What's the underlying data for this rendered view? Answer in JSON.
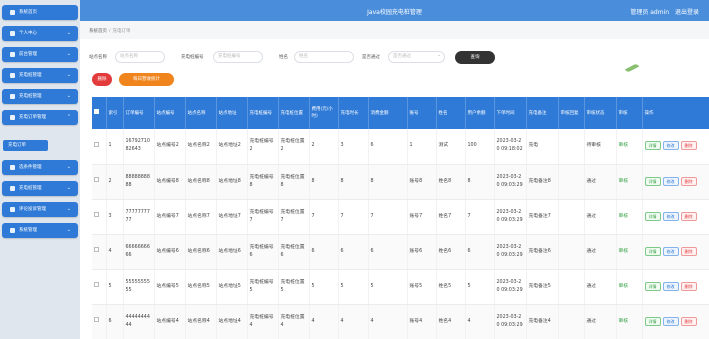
{
  "header": {
    "title": "Java校园充电桩管理",
    "user_label": "管理员 admin",
    "logout": "退出登录"
  },
  "sidebar": {
    "items": [
      {
        "label": "系统首页",
        "icon": "home-icon",
        "chevron": ""
      },
      {
        "label": "个人中心",
        "icon": "user-icon",
        "chevron": "⌄"
      },
      {
        "label": "前台管理",
        "icon": "grid-icon",
        "chevron": "⌄"
      },
      {
        "label": "充电桩管理",
        "icon": "battery-icon",
        "chevron": "⌄"
      },
      {
        "label": "充电桩管理",
        "icon": "list-icon",
        "chevron": "⌄"
      },
      {
        "label": "充电订单管理",
        "icon": "order-icon",
        "chevron": "⌃"
      },
      {
        "label": "选条件管理",
        "icon": "filter-icon",
        "chevron": "⌄"
      },
      {
        "label": "充电桩管理",
        "icon": "plug-icon",
        "chevron": "⌄"
      },
      {
        "label": "评论投诉管理",
        "icon": "comment-icon",
        "chevron": "⌄"
      },
      {
        "label": "系统管理",
        "icon": "gear-icon",
        "chevron": "⌄"
      }
    ],
    "active_sub": "充电订单"
  },
  "breadcrumb": {
    "home": "系统首页",
    "separator": "/",
    "current": "充电订单"
  },
  "search": {
    "station_name_label": "站点名称",
    "station_name_placeholder": "站点名称",
    "pile_no_label": "充电桩编号",
    "pile_no_placeholder": "充电桩编号",
    "name_label": "姓名",
    "name_placeholder": "姓名",
    "audit_label": "是否通过",
    "audit_placeholder": "是否通过",
    "query_button": "查询"
  },
  "actions": {
    "delete": "删除",
    "stats": "每日营收统计"
  },
  "table": {
    "columns": [
      "索引",
      "订单编号",
      "站点编号",
      "站点名称",
      "站点地址",
      "充电桩编号",
      "充电桩位置",
      "费用(元/小时)",
      "充电时长",
      "消费金额",
      "账号",
      "姓名",
      "用户余额",
      "下单时间",
      "充电备注",
      "审核回复",
      "审核状态",
      "审核",
      "操作"
    ],
    "rows": [
      [
        "1",
        "1679271082643",
        "站点编号2",
        "站点名称2",
        "站点地址2",
        "充电桩编号2",
        "充电桩位置2",
        "2",
        "3",
        "6",
        "1",
        "测试",
        "100",
        "2023-03-20 09:18:02",
        "充电",
        "",
        "待审核",
        "审核"
      ],
      [
        "2",
        "8888888888",
        "站点编号8",
        "站点名称8",
        "站点地址8",
        "充电桩编号8",
        "充电桩位置8",
        "8",
        "8",
        "8",
        "账号8",
        "姓名8",
        "8",
        "2023-03-20 09:03:29",
        "充电备注8",
        "",
        "通过",
        "审核"
      ],
      [
        "3",
        "7777777777",
        "站点编号7",
        "站点名称7",
        "站点地址7",
        "充电桩编号7",
        "充电桩位置7",
        "7",
        "7",
        "7",
        "账号7",
        "姓名7",
        "7",
        "2023-03-20 09:03:29",
        "充电备注7",
        "",
        "通过",
        "审核"
      ],
      [
        "4",
        "6666666666",
        "站点编号6",
        "站点名称6",
        "站点地址6",
        "充电桩编号6",
        "充电桩位置6",
        "6",
        "6",
        "6",
        "账号6",
        "姓名6",
        "6",
        "2023-03-20 09:03:29",
        "充电备注6",
        "",
        "通过",
        "审核"
      ],
      [
        "5",
        "5555555555",
        "站点编号5",
        "站点名称5",
        "站点地址5",
        "充电桩编号5",
        "充电桩位置5",
        "5",
        "5",
        "5",
        "账号5",
        "姓名5",
        "5",
        "2023-03-20 09:03:29",
        "充电备注5",
        "",
        "通过",
        "审核"
      ],
      [
        "6",
        "4444444444",
        "站点编号4",
        "站点名称4",
        "站点地址4",
        "充电桩编号4",
        "充电桩位置4",
        "4",
        "4",
        "4",
        "账号4",
        "姓名4",
        "4",
        "2023-03-20 09:03:29",
        "充电备注4",
        "",
        "通过",
        "审核"
      ]
    ],
    "row_buttons": {
      "detail": "详情",
      "edit": "修改",
      "delete": "删除"
    }
  },
  "colors": {
    "primary": "#2f7ad6",
    "header": "#4a8edb",
    "danger": "#e33b3b",
    "warning": "#f0841d",
    "success": "#3aa34a"
  }
}
